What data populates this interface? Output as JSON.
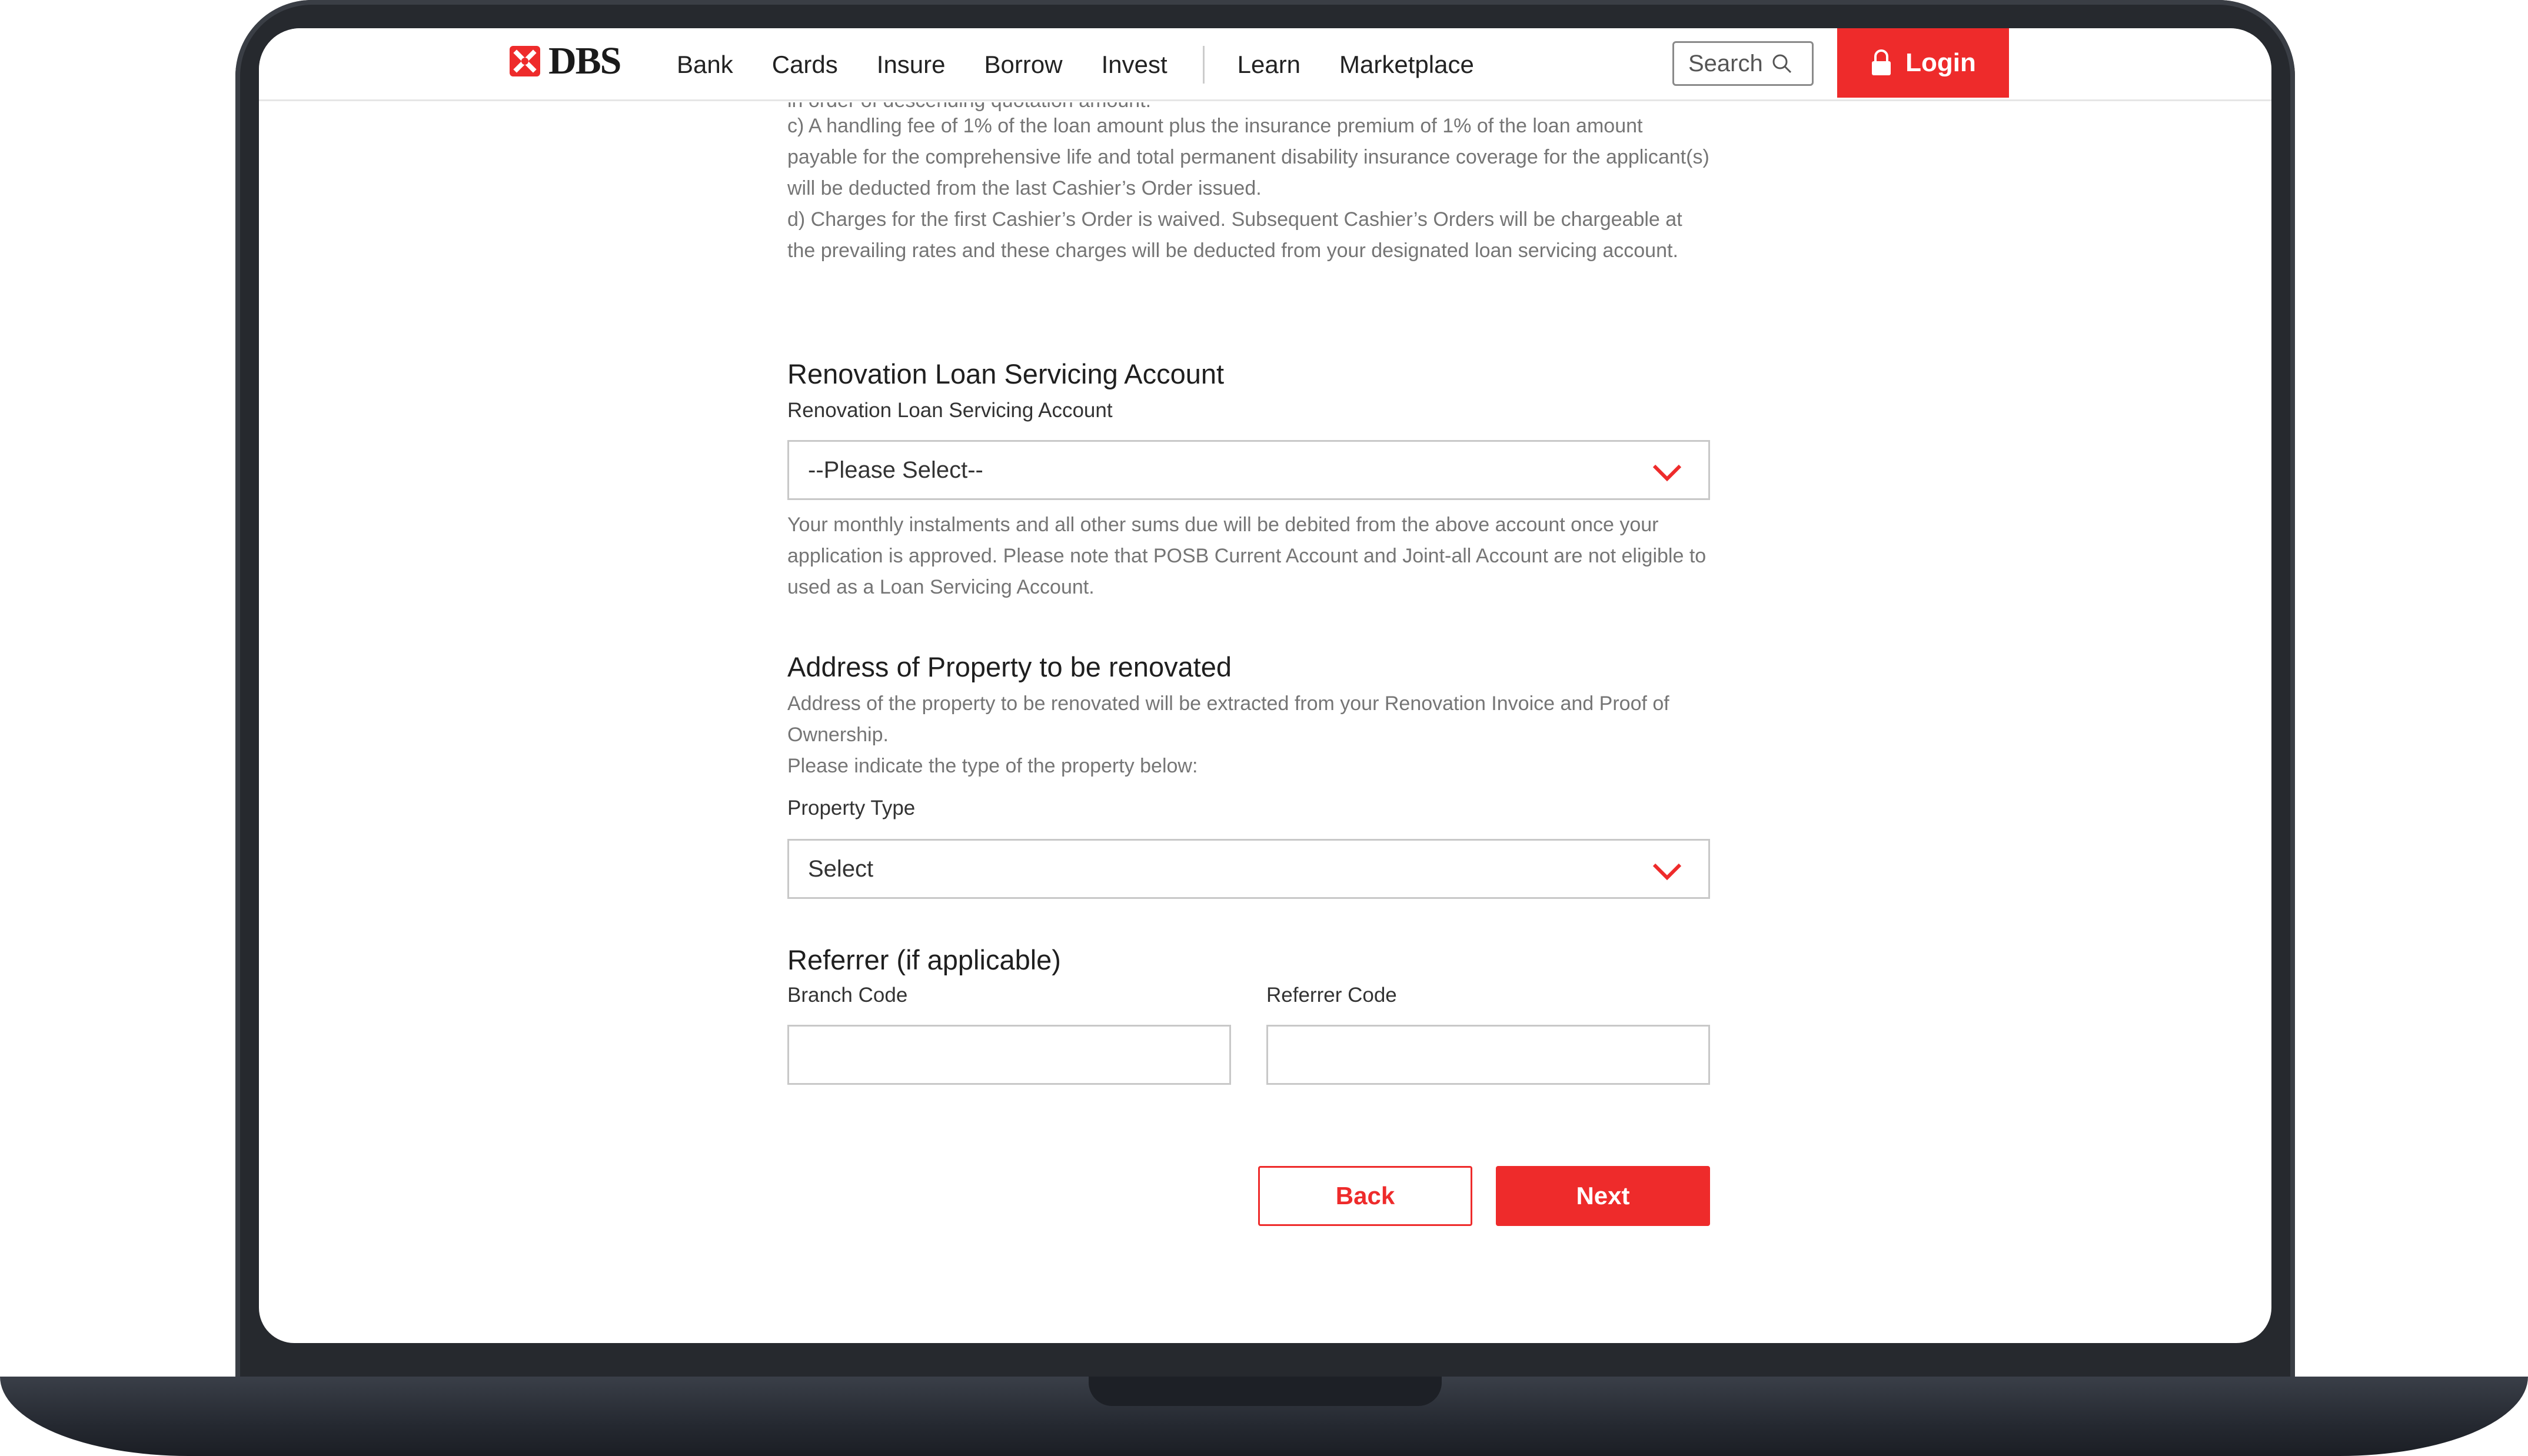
{
  "header": {
    "logo_text": "DBS",
    "nav": [
      "Bank",
      "Cards",
      "Insure",
      "Borrow",
      "Invest",
      "Learn",
      "Marketplace"
    ],
    "search_label": "Search",
    "login_label": "Login"
  },
  "intro": {
    "clipped_line": "in order of descending quotation amount.",
    "paragraph_c": "c) A handling fee of 1% of the loan amount plus the insurance premium of 1% of the loan amount payable for the comprehensive life and total permanent disability insurance coverage for the applicant(s) will be deducted from the last Cashier’s Order issued.",
    "paragraph_d": "d) Charges for the first Cashier’s Order is waived. Subsequent Cashier’s Orders will be chargeable at the prevailing rates and these charges will be deducted from your designated loan servicing account."
  },
  "servicing": {
    "title": "Renovation Loan Servicing Account",
    "label": "Renovation Loan Servicing Account",
    "selected": "--Please Select--",
    "note": "Your monthly instalments and all other sums due will be debited from the above account once your application is approved. Please note that POSB Current Account and Joint-all Account are not eligible to used as a Loan Servicing Account."
  },
  "property": {
    "title": "Address of Property to be renovated",
    "note1": "Address of the property to be renovated will be extracted from your Renovation Invoice and Proof of Ownership.",
    "note2": "Please indicate the type of the property below:",
    "label": "Property Type",
    "selected": "Select"
  },
  "referrer": {
    "title": "Referrer (if applicable)",
    "branch_label": "Branch Code",
    "branch_value": "",
    "code_label": "Referrer Code",
    "code_value": ""
  },
  "buttons": {
    "back": "Back",
    "next": "Next"
  },
  "colors": {
    "brand_red": "#ee2b2b",
    "frame": "#26292e"
  }
}
